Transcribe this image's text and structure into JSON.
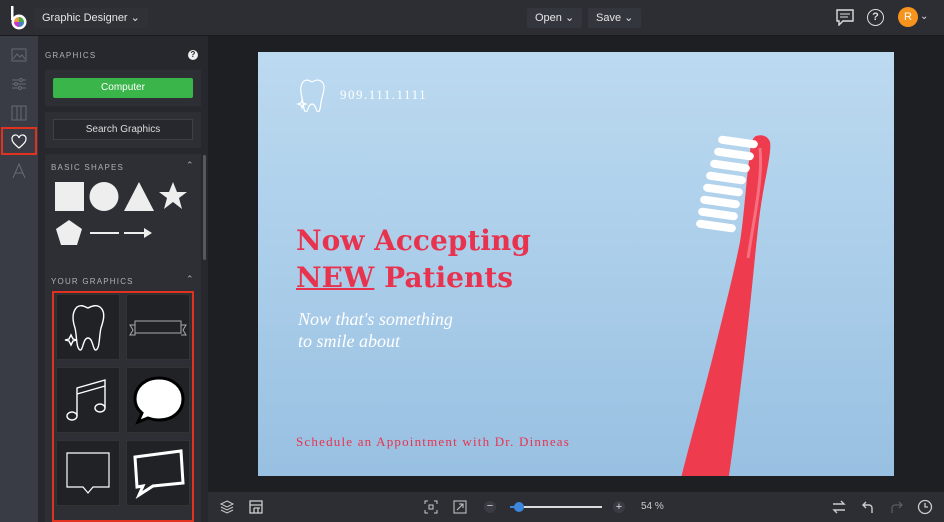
{
  "topbar": {
    "app_title": "Graphic Designer",
    "open_label": "Open",
    "save_label": "Save",
    "avatar_initial": "R"
  },
  "rail": {
    "items": [
      "image-icon",
      "sliders-icon",
      "columns-icon",
      "heart-icon",
      "text-icon"
    ],
    "active": "heart-icon"
  },
  "panel": {
    "title": "GRAPHICS",
    "help": "?",
    "computer_label": "Computer",
    "search_label": "Search Graphics",
    "basic_shapes_title": "BASIC SHAPES",
    "your_graphics_title": "YOUR GRAPHICS"
  },
  "design": {
    "phone": "909.111.1111",
    "headline_1": "Now Accepting",
    "headline_2a": "NEW",
    "headline_2b": " Patients",
    "sub_1": "Now that's something",
    "sub_2": "to smile about",
    "footer": "Schedule an Appointment with Dr. Dinneas"
  },
  "bottom": {
    "zoom_label": "54 %",
    "zoom_value": 0.1
  },
  "colors": {
    "accent_green": "#3ab54a",
    "highlight_red": "#e0321e",
    "headline": "#e8334f",
    "avatar": "#f7941d"
  }
}
